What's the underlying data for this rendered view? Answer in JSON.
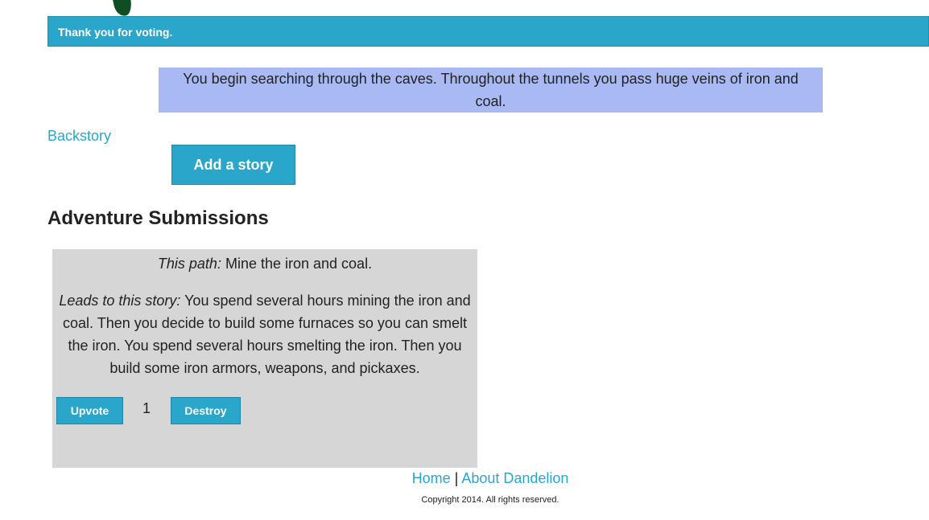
{
  "notice": {
    "text": "Thank you for voting."
  },
  "story": {
    "text": "You begin searching through the caves. Throughout the tunnels you pass huge veins of iron and coal."
  },
  "links": {
    "backstory": "Backstory"
  },
  "actions": {
    "add_story_label": "Add a story"
  },
  "submissions": {
    "title": "Adventure Submissions",
    "items": [
      {
        "path_label": "This path:",
        "path_text": " Mine the iron and coal.",
        "leads_label": "Leads to this story:",
        "leads_text": " You spend several hours mining the iron and coal. Then you decide to build some furnaces so you can smelt the iron. You spend several hours smelting the iron. Then you build some iron armors, weapons, and pickaxes.",
        "upvote_label": "Upvote",
        "votes": "1",
        "destroy_label": "Destroy"
      }
    ]
  },
  "footer": {
    "home": "Home",
    "separator": "|",
    "about": "About Dandelion",
    "copyright": "Copyright 2014. All rights reserved."
  },
  "colors": {
    "accent": "#2aa6cb",
    "story_bg": "#a8b9f3",
    "card_bg": "#d6d6d6",
    "leaf": "#0f4d22"
  }
}
